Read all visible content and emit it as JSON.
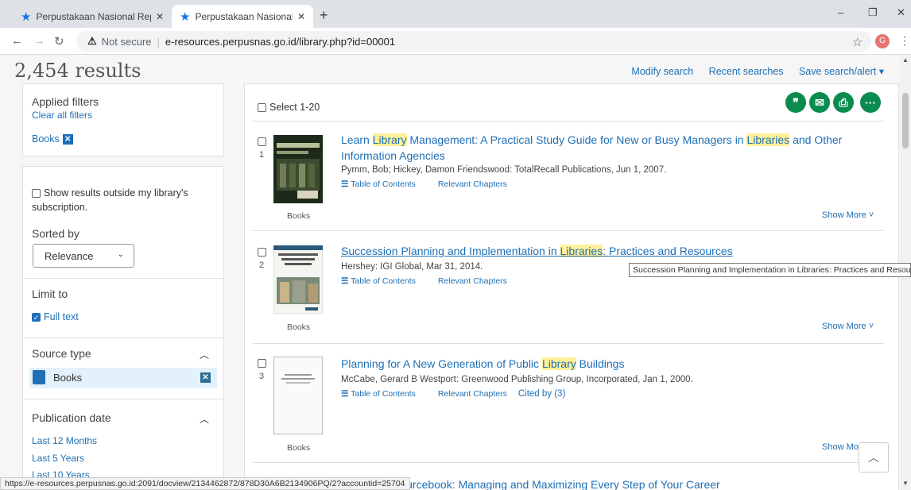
{
  "browser": {
    "tabs": [
      {
        "title": "Perpustakaan Nasional Republik"
      },
      {
        "title": "Perpustakaan Nasional Republik"
      }
    ],
    "not_secure": "Not secure",
    "url": "e-resources.perpusnas.go.id/library.php?id=00001",
    "profile_initial": "G"
  },
  "header": {
    "results_count": "2,454 results",
    "links": [
      "Modify search",
      "Recent searches",
      "Save search/alert ▾"
    ]
  },
  "sidebar": {
    "applied_filters_title": "Applied filters",
    "clear_all": "Clear all filters",
    "active_filter": "Books",
    "show_outside": "Show results outside my library's subscription.",
    "sorted_by": "Sorted by",
    "sort_value": "Relevance",
    "limit_to": "Limit to",
    "full_text": "Full text",
    "source_type": "Source type",
    "source_value": "Books",
    "pub_date": "Publication date",
    "date_options": [
      "Last 12 Months",
      "Last 5 Years",
      "Last 10 Years"
    ]
  },
  "main": {
    "select_label": "Select 1-20",
    "results": [
      {
        "num": "1",
        "title_parts": [
          "Learn ",
          "Library",
          " Management: A Practical Study Guide for New or Busy Managers in ",
          "Libraries",
          " and Other Information Agencies"
        ],
        "authors": "Pymm, Bob; Hickey, Damon Friendswood: TotalRecall Publications, Jun 1, 2007.",
        "links": [
          "Table of Contents",
          "Relevant Chapters"
        ],
        "type": "Books",
        "show_more": "Show More ˅"
      },
      {
        "num": "2",
        "title_parts": [
          "Succession Planning and Implementation in ",
          "Libraries",
          ": Practices and Resources"
        ],
        "authors": "Hershey: IGI Global, Mar 31, 2014.",
        "links": [
          "Table of Contents",
          "Relevant Chapters"
        ],
        "type": "Books",
        "show_more": "Show More ˅"
      },
      {
        "num": "3",
        "title_parts": [
          "Planning for A New Generation of Public ",
          "Library",
          " Buildings"
        ],
        "authors": "McCabe, Gerard B Westport: Greenwood Publishing Group, Incorporated, Jan 1, 2000.",
        "links": [
          "Table of Contents",
          "Relevant Chapters",
          "Cited by (3)"
        ],
        "type": "Books",
        "show_more": "Show More"
      }
    ],
    "partial_title": "Sourcebook: Managing and Maximizing Every Step of Your Career"
  },
  "tooltip": "Succession Planning and Implementation in Libraries: Practices and Resources",
  "status_url": "https://e-resources.perpusnas.go.id:2091/docview/2134462872/878D30A6B2134906PQ/2?accountid=25704",
  "colors": {
    "accent": "#1e6fb5",
    "action_green": "#0b8c4f",
    "highlight": "#fff099"
  }
}
